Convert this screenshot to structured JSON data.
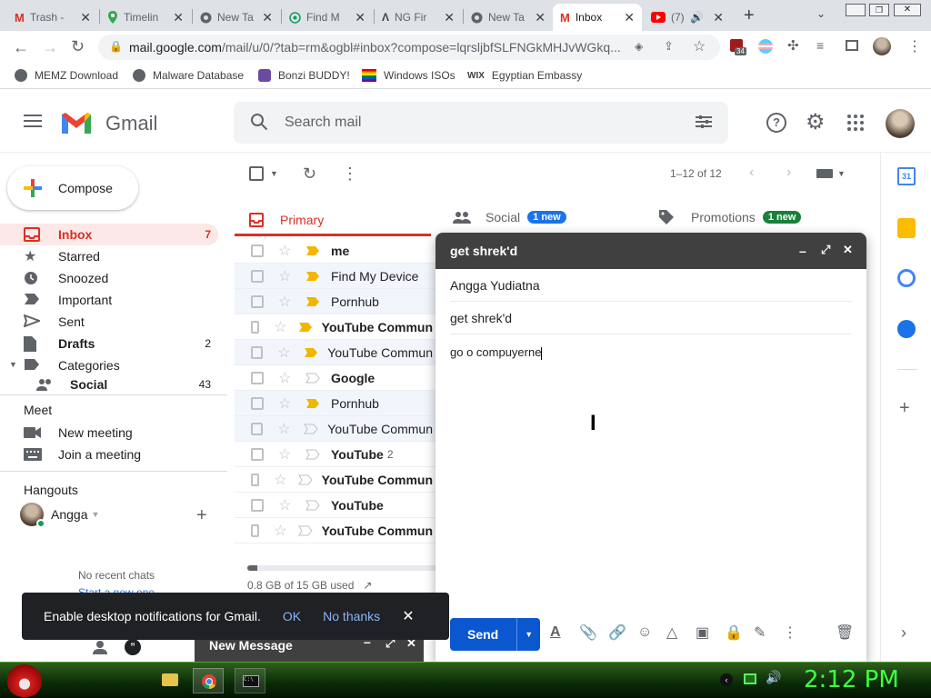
{
  "browser": {
    "tabs": [
      {
        "label": "Trash -",
        "icon": "gmail-icon"
      },
      {
        "label": "Timelin",
        "icon": "maps-pin-icon"
      },
      {
        "label": "New Ta",
        "icon": "chrome-icon"
      },
      {
        "label": "Find M",
        "icon": "find-device-icon"
      },
      {
        "label": "NG Fir",
        "icon": "ng-icon"
      },
      {
        "label": "New Ta",
        "icon": "chrome-icon"
      },
      {
        "label": "Inbox",
        "icon": "gmail-icon"
      },
      {
        "label": "(7)",
        "icon": "youtube-icon"
      }
    ],
    "url_main": "mail.google.com",
    "url_rest": "/mail/u/0/?tab=rm&ogbl#inbox?compose=lqrsljbfSLFNGkMHJvWGkq...",
    "extension_badge": "34",
    "bookmarks": [
      "MEMZ Download",
      "Malware Database",
      "Bonzi BUDDY!",
      "Windows ISOs",
      "Egyptian Embassy"
    ]
  },
  "gmail": {
    "logo_text": "Gmail",
    "search_placeholder": "Search mail",
    "compose_label": "Compose",
    "nav": [
      {
        "label": "Inbox",
        "count": "7"
      },
      {
        "label": "Starred",
        "count": ""
      },
      {
        "label": "Snoozed",
        "count": ""
      },
      {
        "label": "Important",
        "count": ""
      },
      {
        "label": "Sent",
        "count": ""
      },
      {
        "label": "Drafts",
        "count": "2"
      },
      {
        "label": "Categories",
        "count": ""
      },
      {
        "label": "Social",
        "count": "43"
      }
    ],
    "meet": {
      "title": "Meet",
      "new_meeting": "New meeting",
      "join": "Join a meeting"
    },
    "hangouts": {
      "title": "Hangouts",
      "user": "Angga",
      "no_chats": "No recent chats",
      "start": "Start a new one"
    },
    "pagination": "1–12 of 12",
    "tabs": [
      {
        "label": "Primary",
        "badge": ""
      },
      {
        "label": "Social",
        "badge": "1 new"
      },
      {
        "label": "Promotions",
        "badge": "1 new"
      }
    ],
    "messages": [
      {
        "sender": "me",
        "count": "",
        "unread": true,
        "important": true
      },
      {
        "sender": "Find My Device",
        "count": "",
        "unread": false,
        "important": true
      },
      {
        "sender": "Pornhub",
        "count": "",
        "unread": false,
        "important": true
      },
      {
        "sender": "YouTube Commun",
        "count": "",
        "unread": true,
        "important": true
      },
      {
        "sender": "YouTube Commun",
        "count": "",
        "unread": false,
        "important": true
      },
      {
        "sender": "Google",
        "count": "",
        "unread": true,
        "important": false
      },
      {
        "sender": "Pornhub",
        "count": "",
        "unread": false,
        "important": true
      },
      {
        "sender": "YouTube Commun",
        "count": "",
        "unread": false,
        "important": false
      },
      {
        "sender": "YouTube",
        "count": "2",
        "unread": true,
        "important": false
      },
      {
        "sender": "YouTube Commun",
        "count": "",
        "unread": true,
        "important": false
      },
      {
        "sender": "YouTube",
        "count": "",
        "unread": true,
        "important": false
      },
      {
        "sender": "YouTube Commun",
        "count": "",
        "unread": true,
        "important": false
      }
    ],
    "storage": "0.8 GB of 15 GB used",
    "storage_fraction": 0.053
  },
  "compose": {
    "title": "get shrek'd",
    "to": "Angga Yudiatna",
    "subject": "get shrek'd",
    "body": "go o compuyerne",
    "send_label": "Send"
  },
  "new_message": {
    "title": "New Message"
  },
  "toast": {
    "text": "Enable desktop notifications for Gmail.",
    "ok": "OK",
    "no": "No thanks"
  },
  "taskbar": {
    "time": "2:12 PM"
  },
  "colors": {
    "gmail_red": "#d93025",
    "blue": "#1a73e8",
    "green_badge": "#188038",
    "taskbar_clock": "#40ff40"
  }
}
